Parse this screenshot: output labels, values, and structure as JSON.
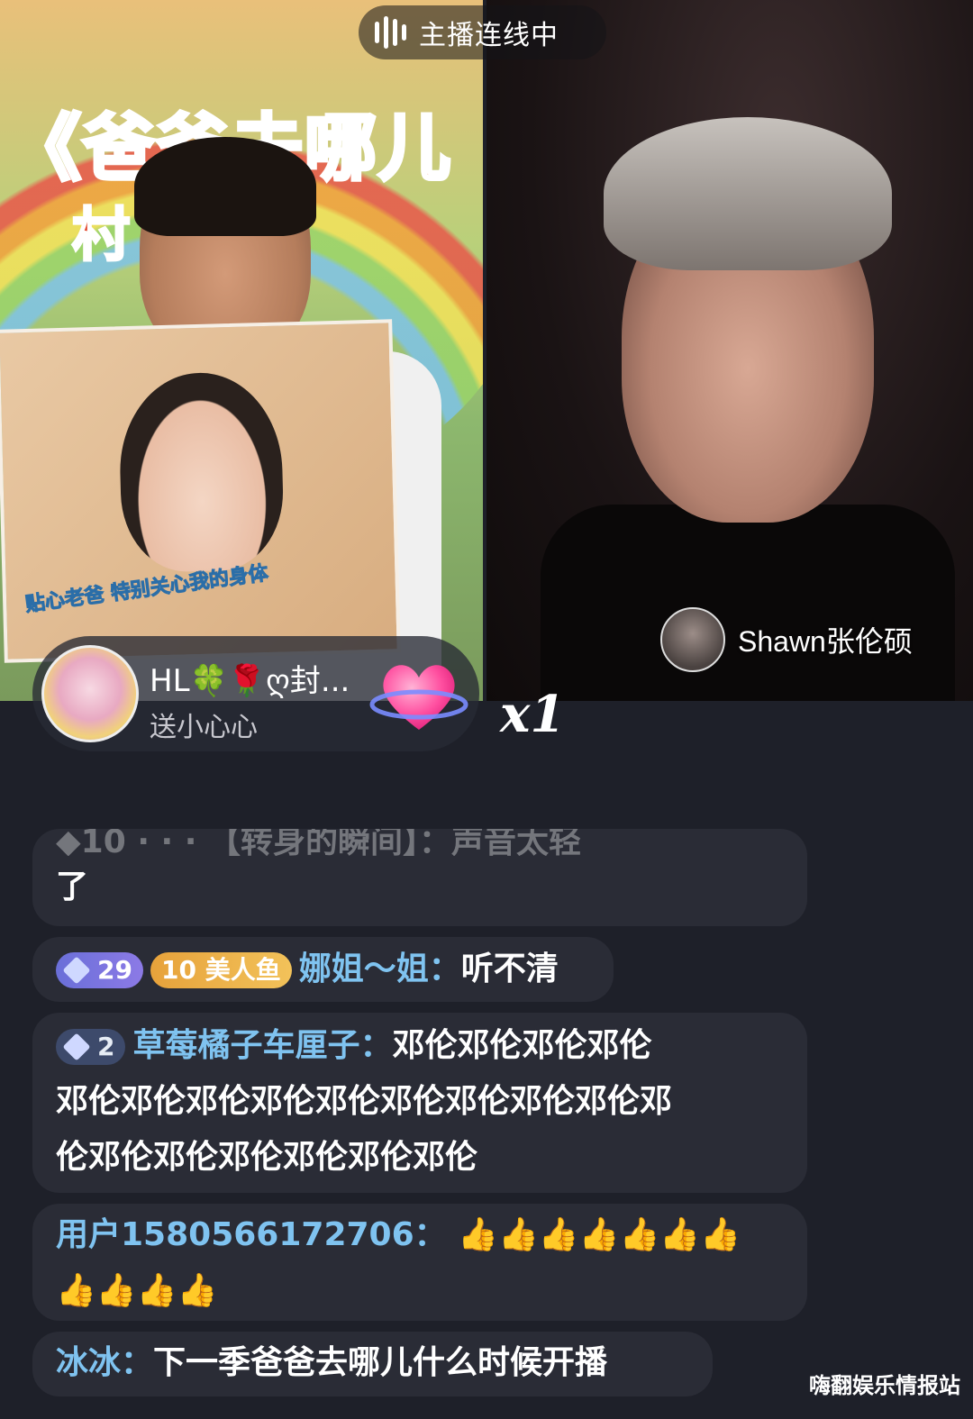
{
  "stream": {
    "status_text": "主播连线中",
    "show_title": "《爸爸去哪儿",
    "show_subtitle": "村  回访",
    "photo_caption": "贴心老爸 特别关心我的身体",
    "guest_name": "Shawn张伦硕"
  },
  "gift": {
    "user": "HL🍀🌹ღ封...",
    "action": "送小心心",
    "count": "x1",
    "icon": "heart-planet-icon"
  },
  "chat": [
    {
      "id": "faded",
      "text": "了"
    },
    {
      "level": "29",
      "fan_level": "10",
      "fan_club": "美人鱼",
      "user": "娜姐～姐：",
      "text": "听不清"
    },
    {
      "level": "2",
      "user": "草莓橘子车厘子：",
      "text_lines": [
        "邓伦邓伦邓伦邓伦",
        "邓伦邓伦邓伦邓伦邓伦邓伦邓伦邓伦邓伦邓",
        "伦邓伦邓伦邓伦邓伦邓伦邓伦"
      ]
    },
    {
      "user": "用户1580566172706：",
      "thumbs_line1": "👍👍👍👍👍👍👍",
      "thumbs_line2": "👍👍👍👍"
    },
    {
      "user": "冰冰：",
      "text": "下一季爸爸去哪儿什么时候开播"
    }
  ],
  "watermark": "嗨翻娱乐情报站",
  "colors": {
    "chat_bg": "#1e2029",
    "bubble_bg": "#2a2c36",
    "username": "#7fc3f0"
  }
}
